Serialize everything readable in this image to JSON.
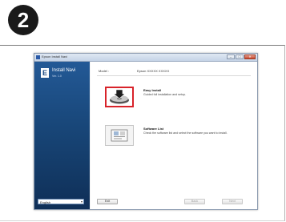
{
  "step": {
    "number": "2"
  },
  "window": {
    "title": "Epson Install Navi",
    "controls": {
      "minimize": "–",
      "maximize": "□",
      "close": "✕"
    }
  },
  "sidebar": {
    "logo_letter": "E",
    "title": "Install Navi",
    "subtitle": "Ver. 1.0",
    "language": {
      "selected": "English"
    }
  },
  "content": {
    "model_label": "Model :",
    "model_value": "Epson XXXXX XXXXX",
    "options": [
      {
        "title": "Easy Install",
        "description": "Guided full installation and setup.",
        "icon": "install-disc-icon",
        "selected": true
      },
      {
        "title": "Software List",
        "description": "Check the software list and select the software you want to install.",
        "icon": "software-list-icon",
        "selected": false
      }
    ]
  },
  "footer": {
    "exit_label": "Exit",
    "back_label": "Back",
    "next_label": "Next"
  },
  "colors": {
    "sidebar": "#184678",
    "selected_border": "#d8232a",
    "badge": "#1a1a1a"
  }
}
